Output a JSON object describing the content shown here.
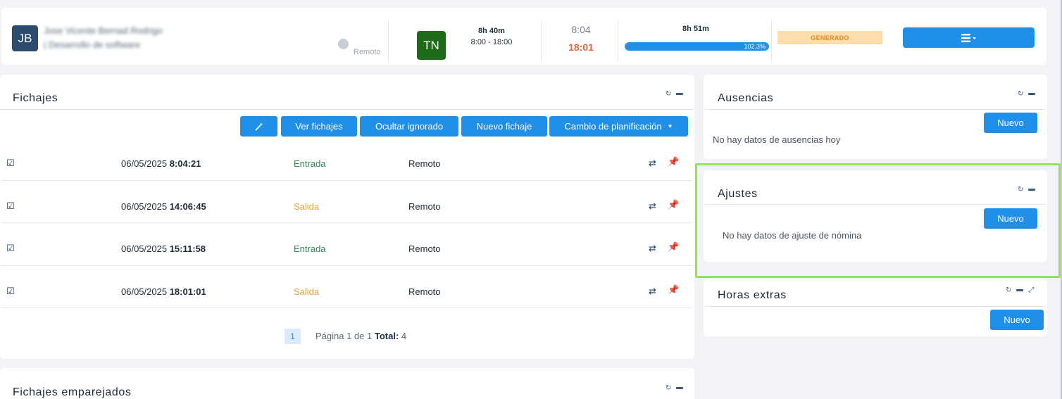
{
  "header": {
    "avatar_initials": "JB",
    "employee_name": "Jose Vicente Bernad Rodrigo",
    "employee_role": "| Desarrollo de software",
    "work_mode": "Remoto",
    "schedule_badge": "TN",
    "schedule_hours": "8h 40m",
    "schedule_range": "8:00 - 18:00",
    "start_time": "8:04",
    "end_time": "18:01",
    "worked_hours": "8h 51m",
    "progress_label": "102.3%",
    "progress_fraction": 1.0,
    "status": "GENERADO",
    "menu_icon": "hamburger-icon"
  },
  "fichajes": {
    "title": "Fichajes",
    "toolbar": {
      "wand_icon": "magic-wand-icon",
      "ver_fichajes": "Ver fichajes",
      "ocultar_ignorado": "Ocultar ignorado",
      "nuevo_fichaje": "Nuevo fichaje",
      "cambio_planificacion": "Cambio de planificación"
    },
    "rows": [
      {
        "date": "06/05/2025",
        "time": "8:04:21",
        "type": "Entrada",
        "mode": "Remoto"
      },
      {
        "date": "06/05/2025",
        "time": "14:06:45",
        "type": "Salida",
        "mode": "Remoto"
      },
      {
        "date": "06/05/2025",
        "time": "15:11:58",
        "type": "Entrada",
        "mode": "Remoto"
      },
      {
        "date": "06/05/2025",
        "time": "18:01:01",
        "type": "Salida",
        "mode": "Remoto"
      }
    ],
    "pager": {
      "current": "1",
      "text": "Página 1 de 1",
      "total_label": "Total:",
      "total": "4"
    }
  },
  "fichajes_emparejados": {
    "title": "Fichajes emparejados"
  },
  "ausencias": {
    "title": "Ausencias",
    "new_label": "Nuevo",
    "empty": "No hay datos de ausencias hoy"
  },
  "ajustes": {
    "title": "Ajustes",
    "new_label": "Nuevo",
    "empty": "No hay datos de ajuste de nómina"
  },
  "horas_extras": {
    "title": "Horas extras",
    "new_label": "Nuevo"
  },
  "colors": {
    "primary": "#1f8fe8",
    "entrada": "#2e8b57",
    "salida": "#e3a23b",
    "end_time": "#e8603c",
    "status_bg": "#fddcae",
    "highlight": "#98e060"
  }
}
